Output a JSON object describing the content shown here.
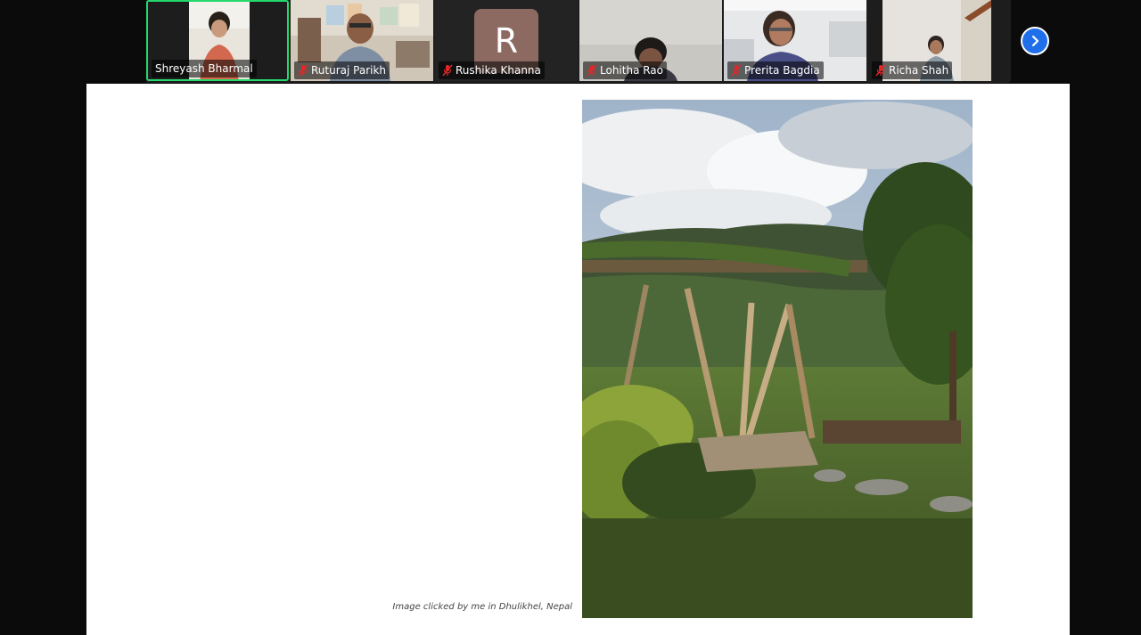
{
  "participants": [
    {
      "name": "Shreyash Bharmal",
      "muted": false,
      "active": true,
      "video": "camera"
    },
    {
      "name": "Ruturaj Parikh",
      "muted": true,
      "active": false,
      "video": "camera"
    },
    {
      "name": "Rushika Khanna",
      "muted": true,
      "active": false,
      "video": "avatar",
      "initial": "R"
    },
    {
      "name": "Lohitha Rao",
      "muted": true,
      "active": false,
      "video": "camera"
    },
    {
      "name": "Prerita Bagdia",
      "muted": true,
      "active": false,
      "video": "camera"
    },
    {
      "name": "Richa Shah",
      "muted": true,
      "active": false,
      "video": "camera"
    }
  ],
  "gallery": {
    "next_icon": "chevron-right-icon",
    "active_color": "#23d96c",
    "muted_color": "#e02828",
    "avatar_color": "#8c6a61"
  },
  "shared_screen": {
    "photo_caption": "Image clicked by me in Dhulikhel, Nepal"
  }
}
